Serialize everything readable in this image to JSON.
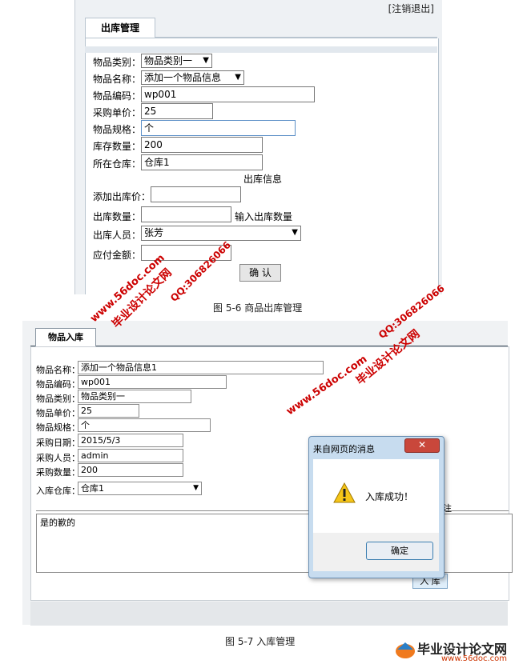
{
  "top": {
    "logout": "[注销退出]",
    "tab": "出库管理",
    "fields": {
      "category_label": "物品类别：",
      "category_value": "物品类别一",
      "name_label": "物品名称：",
      "name_value": "添加一个物品信息",
      "code_label": "物品编码：",
      "code_value": "wp001",
      "price_label": "采购单价：",
      "price_value": "25",
      "spec_label": "物品规格：",
      "spec_value": "个",
      "stock_label": "库存数量：",
      "stock_value": "200",
      "warehouse_label": "所在仓库：",
      "warehouse_value": "仓库1"
    },
    "section_title": "出库信息",
    "out": {
      "price_label": "添加出库价：",
      "price_value": "",
      "qty_label": "出库数量：",
      "qty_value": "",
      "qty_hint": "输入出库数量",
      "person_label": "出库人员：",
      "person_value": "张芳",
      "amount_label": "应付金额：",
      "amount_value": ""
    },
    "confirm_button": "确 认"
  },
  "caption1": "图 5-6 商品出库管理",
  "bottom": {
    "tab": "物品入库",
    "fields": {
      "name_label": "物品名称：",
      "name_value": "添加一个物品信息1",
      "code_label": "物品编码：",
      "code_value": "wp001",
      "category_label": "物品类别：",
      "category_value": "物品类别一",
      "price_label": "物品单价：",
      "price_value": "25",
      "spec_label": "物品规格：",
      "spec_value": "个",
      "date_label": "采购日期：",
      "date_value": "2015/5/3",
      "buyer_label": "采购人员：",
      "buyer_value": "admin",
      "qty_label": "采购数量：",
      "qty_value": "200",
      "warehouse_label": "入库仓库：",
      "warehouse_value": "仓库1"
    },
    "notes_value": "是的歉的",
    "submit_button": "入 库",
    "partial_text": "注"
  },
  "dialog": {
    "title": "来自网页的消息",
    "close_glyph": "✕",
    "message": "入库成功！",
    "ok_button": "确定"
  },
  "caption2": "图 5-7 入库管理",
  "watermarks": {
    "site": "www.56doc.com",
    "qq": "QQ:306826066",
    "brand": "毕业设计论文网"
  },
  "logo": {
    "name": "毕业设计论文网",
    "url": "www.56doc.com"
  },
  "colors": {
    "watermark": "#cc0000",
    "dialog_frame": "#c7dcef",
    "close_button": "#c9473b"
  }
}
